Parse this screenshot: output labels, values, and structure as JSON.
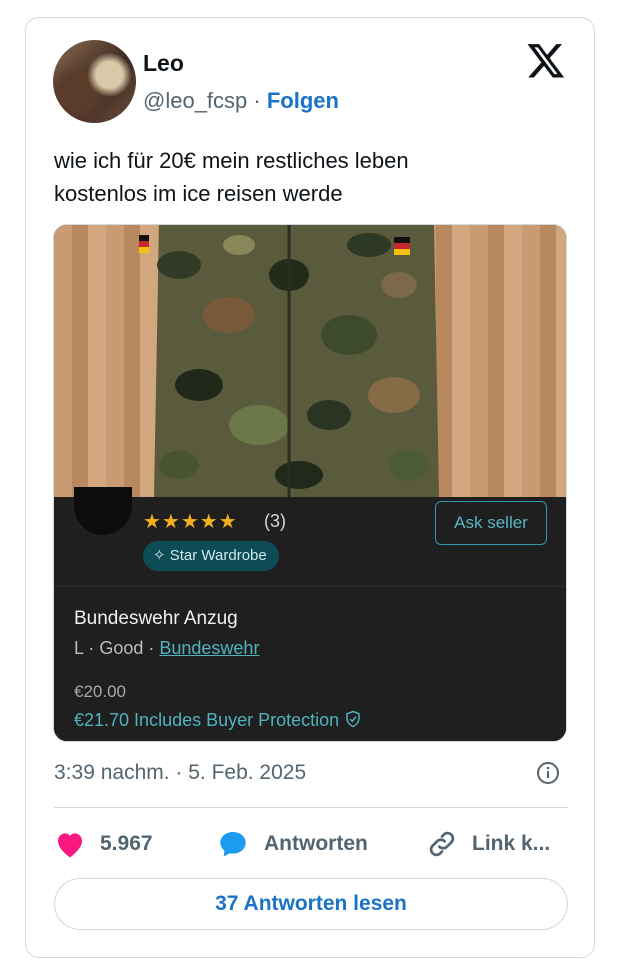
{
  "author": {
    "name": "Leo",
    "handle": "@leo_fcsp",
    "separator": " · ",
    "follow_label": "Folgen"
  },
  "tweet": {
    "text_line1": "wie ich für 20€ mein restliches leben",
    "text_line2": "kostenlos im ice reisen werde"
  },
  "listing": {
    "stars": "★★★★★",
    "rating_count": "(3)",
    "badge": "Star Wardrobe",
    "ask_seller": "Ask seller",
    "title": "Bundeswehr Anzug",
    "meta_prefix": "L · Good · ",
    "brand": "Bundeswehr",
    "price": "€20.00",
    "price_with_protection": "€21.70 Includes Buyer Protection"
  },
  "timestamp": "3:39 nachm. · 5. Feb. 2025",
  "actions": {
    "likes": "5.967",
    "reply_label": "Antworten",
    "link_label": "Link k..."
  },
  "read_replies": "37 Antworten lesen",
  "colors": {
    "like": "#f91880",
    "link_blue": "#1a73c7",
    "teal": "#4fb3bf",
    "star": "#f2b01e"
  },
  "icons": [
    "x-logo-icon",
    "star-icon",
    "sparkle-icon",
    "shield-check-icon",
    "info-icon",
    "heart-icon",
    "reply-bubble-icon",
    "link-icon"
  ]
}
